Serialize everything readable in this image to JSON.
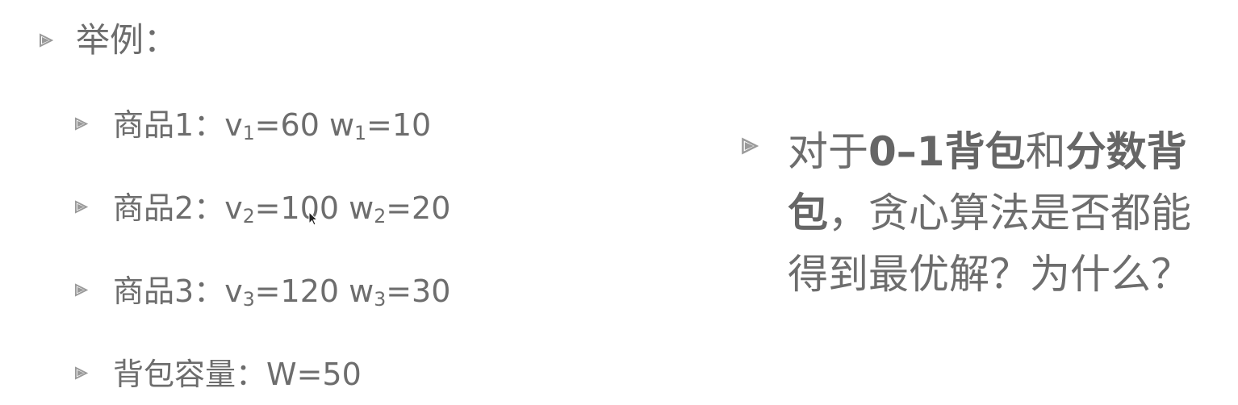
{
  "left": {
    "heading": "举例：",
    "items": [
      {
        "prefix": "商品1：",
        "v_sub": "1",
        "v_val": "=60",
        "w_sub": "1",
        "w_val": "=10"
      },
      {
        "prefix": "商品2：",
        "v_sub": "2",
        "v_val": "=100",
        "w_sub": "2",
        "w_val": "=20"
      },
      {
        "prefix": "商品3：",
        "v_sub": "3",
        "v_val": "=120",
        "w_sub": "3",
        "w_val": "=30"
      }
    ],
    "capacity": "背包容量：W=50",
    "v_letter": "v",
    "w_letter": " w"
  },
  "right": {
    "part1": "对于",
    "bold1": "0–1背包",
    "part2": "和",
    "bold2": "分数背包",
    "part3": "，贪心算法是否都能得到最优解？为什么？"
  },
  "colors": {
    "text": "#6d6d6d",
    "bullet": "#9a9a9a",
    "background": "#ffffff"
  }
}
